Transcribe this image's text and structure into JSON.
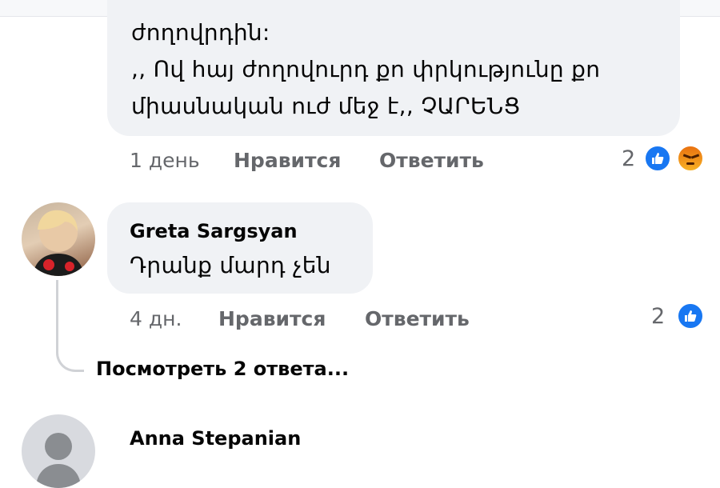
{
  "comment1": {
    "lines": [
      "ժողովրդին:",
      ",, Ով հայ ժողովուրդ քո փրկությունը քո",
      "միասնական ուժ մեջ է,, ՉԱՐԵՆՑ"
    ],
    "time": "1 день",
    "like_label": "Нравится",
    "reply_label": "Ответить",
    "reaction_count": "2",
    "reaction_icons": [
      "like-icon",
      "angry-icon"
    ]
  },
  "comment2": {
    "author": "Greta Sargsyan",
    "text": "Դրանք մարդ չեն",
    "time": "4 дн.",
    "like_label": "Нравится",
    "reply_label": "Ответить",
    "reaction_count": "2",
    "reaction_icons": [
      "like-icon"
    ],
    "view_replies": "Посмотреть 2 ответа..."
  },
  "comment3": {
    "author": "Anna Stepanian"
  },
  "colors": {
    "bubble": "#f0f2f5",
    "meta_text": "#65676b",
    "like_blue": "#1877f2"
  }
}
